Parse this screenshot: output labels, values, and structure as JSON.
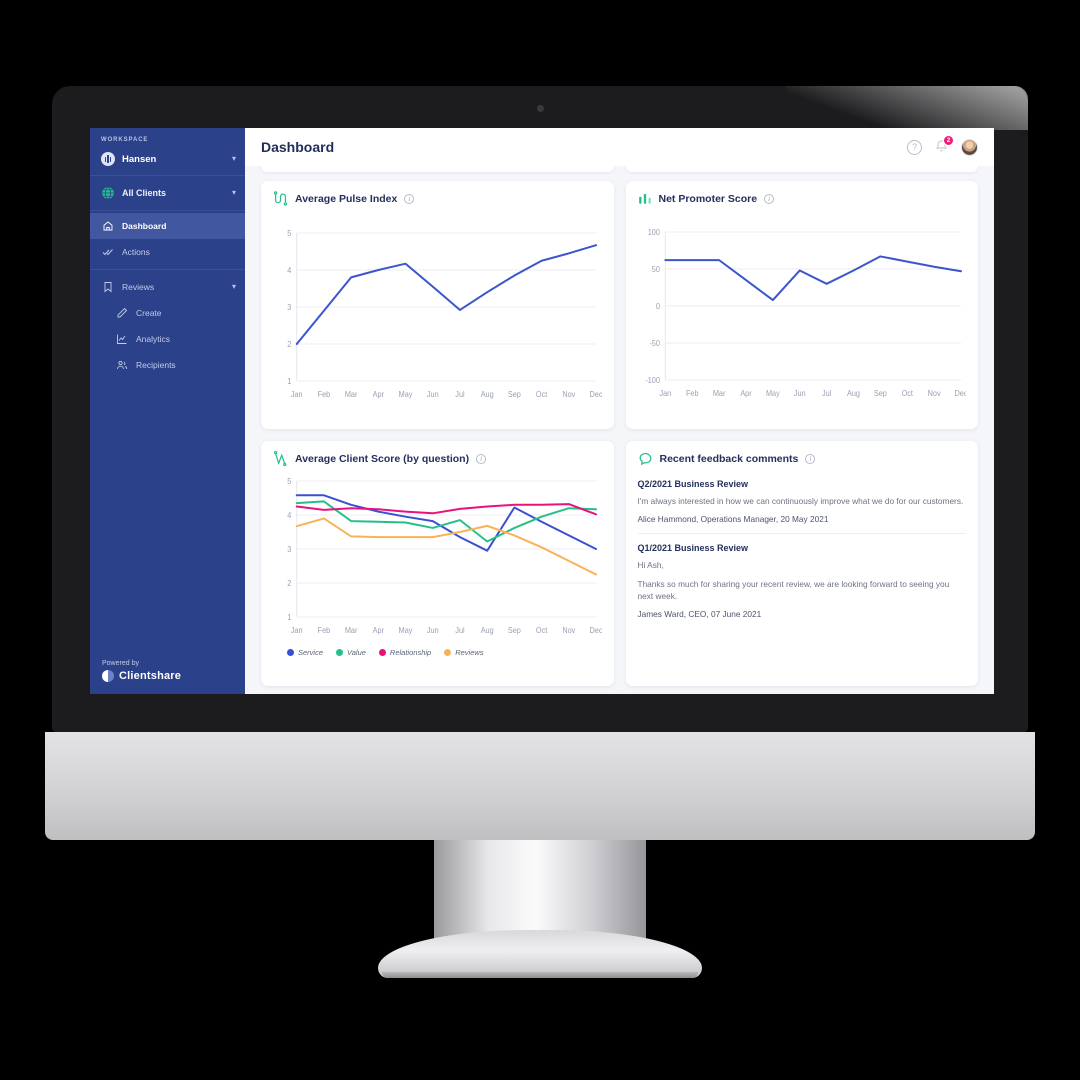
{
  "sidebar": {
    "workspace_label": "WORKSPACE",
    "workspace_name": "Hansen",
    "clients_label": "All Clients",
    "nav": [
      {
        "label": "Dashboard",
        "icon": "home-icon",
        "active": true
      },
      {
        "label": "Actions",
        "icon": "check-double-icon",
        "active": false
      },
      {
        "label": "Reviews",
        "icon": "bookmark-icon",
        "active": false
      },
      {
        "label": "Create",
        "icon": "pencil-icon",
        "active": false
      },
      {
        "label": "Analytics",
        "icon": "chart-line-icon",
        "active": false
      },
      {
        "label": "Recipients",
        "icon": "people-icon",
        "active": false
      }
    ],
    "powered_by": "Powered by",
    "brand": "Clientshare"
  },
  "header": {
    "title": "Dashboard",
    "help_icon": "question-circle-icon",
    "bell_icon": "bell-icon",
    "notification_count": "2",
    "avatar": "user-avatar"
  },
  "cards": {
    "pulse": {
      "title": "Average Pulse Index",
      "icon": "pulse-line-icon"
    },
    "nps": {
      "title": "Net Promoter Score",
      "icon": "bar-chart-icon"
    },
    "client_score": {
      "title": "Average Client Score (by question)",
      "icon": "zigzag-line-icon"
    },
    "comments": {
      "title": "Recent feedback comments",
      "icon": "speech-bubble-icon"
    }
  },
  "comments": [
    {
      "title": "Q2/2021 Business Review",
      "body": "I'm always interested in how we can continuously improve what we do for our customers.",
      "meta": "Alice Hammond, Operations Manager, 20 May 2021"
    },
    {
      "title": "Q1/2021 Business Review",
      "greeting": "Hi Ash,",
      "body": "Thanks so much for sharing your recent review, we are looking forward to seeing you next week.",
      "meta": "James Ward, CEO, 07 June 2021"
    }
  ],
  "colors": {
    "sidebar": "#2b4189",
    "sidebar_active": "#41579f",
    "accent_green": "#25c08a",
    "badge_pink": "#ec1e79",
    "series_service": "#3b4fd4",
    "series_value": "#25c08a",
    "series_relationship": "#e8127c",
    "series_reviews": "#f9b357",
    "line_blue": "#3b55cc"
  },
  "chart_data": [
    {
      "type": "line",
      "title": "Average Pulse Index",
      "categories": [
        "Jan",
        "Feb",
        "Mar",
        "Apr",
        "May",
        "Jun",
        "Jul",
        "Aug",
        "Sep",
        "Oct",
        "Nov",
        "Dec"
      ],
      "values": [
        2.0,
        2.9,
        3.8,
        4.0,
        4.17,
        3.55,
        2.92,
        3.4,
        3.85,
        4.25,
        4.45,
        4.67
      ],
      "xlabel": "",
      "ylabel": "",
      "ylim": [
        1,
        5
      ],
      "yticks": [
        1,
        2,
        3,
        4,
        5
      ],
      "grid": true,
      "legend": "none",
      "series_color": "#3b55cc"
    },
    {
      "type": "line",
      "title": "Net Promoter Score",
      "categories": [
        "Jan",
        "Feb",
        "Mar",
        "Apr",
        "May",
        "Jun",
        "Jul",
        "Aug",
        "Sep",
        "Oct",
        "Nov",
        "Dec"
      ],
      "values": [
        62,
        62,
        62,
        35,
        8,
        48,
        30,
        48,
        67,
        60,
        53,
        47
      ],
      "xlabel": "",
      "ylabel": "",
      "ylim": [
        -100,
        100
      ],
      "yticks": [
        -100,
        -50,
        0,
        50,
        100
      ],
      "grid": true,
      "legend": "none",
      "series_color": "#3b55cc"
    },
    {
      "type": "line",
      "title": "Average Client Score (by question)",
      "categories": [
        "Jan",
        "Feb",
        "Mar",
        "Apr",
        "May",
        "Jun",
        "Jul",
        "Aug",
        "Sep",
        "Oct",
        "Nov",
        "Dec"
      ],
      "ylim": [
        1,
        5
      ],
      "yticks": [
        1,
        2,
        3,
        4,
        5
      ],
      "grid": true,
      "legend": "bottom",
      "series": [
        {
          "name": "Service",
          "color": "#3b4fd4",
          "values": [
            4.58,
            4.58,
            4.3,
            4.1,
            3.95,
            3.82,
            3.35,
            2.95,
            4.22,
            3.8,
            3.4,
            3.0
          ]
        },
        {
          "name": "Value",
          "color": "#25c08a",
          "values": [
            4.35,
            4.4,
            3.82,
            3.8,
            3.78,
            3.62,
            3.85,
            3.22,
            3.62,
            3.95,
            4.2,
            4.17
          ]
        },
        {
          "name": "Relationship",
          "color": "#e8127c",
          "values": [
            4.25,
            4.15,
            4.2,
            4.17,
            4.1,
            4.05,
            4.18,
            4.25,
            4.3,
            4.3,
            4.32,
            4.02
          ]
        },
        {
          "name": "Reviews",
          "color": "#f9b357",
          "values": [
            3.67,
            3.9,
            3.37,
            3.35,
            3.35,
            3.35,
            3.5,
            3.68,
            3.4,
            3.05,
            2.65,
            2.25
          ]
        }
      ]
    }
  ]
}
